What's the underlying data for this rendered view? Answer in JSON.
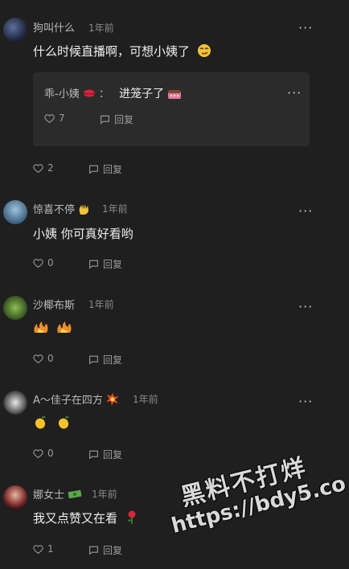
{
  "comments": [
    {
      "username": "狗叫什么",
      "time": "1年前",
      "text": "什么时候直播啊，可想小姨了",
      "reply": {
        "username": "乖-小姨",
        "separator": "：",
        "text": "进笼子了",
        "likes": "7",
        "reply_label": "回复"
      },
      "likes": "2",
      "reply_label": "回复"
    },
    {
      "username": "惊喜不停",
      "time": "1年前",
      "text": "小姨 你可真好看哟",
      "likes": "0",
      "reply_label": "回复"
    },
    {
      "username": "沙椰布斯",
      "time": "1年前",
      "text": "",
      "likes": "0",
      "reply_label": "回复"
    },
    {
      "username": "A～佳子在四方",
      "time": "1年前",
      "text": "",
      "likes": "0",
      "reply_label": "回复"
    },
    {
      "username": "娜女士",
      "time": "1年前",
      "text": "我又点赞又在看",
      "likes": "1",
      "reply_label": "回复"
    }
  ],
  "watermark": {
    "line1": "黑料不打烊",
    "line2": "https://bdy5.co"
  },
  "icons": {
    "more": "more-icon",
    "like": "heart-icon",
    "reply": "comment-bubble-icon"
  }
}
